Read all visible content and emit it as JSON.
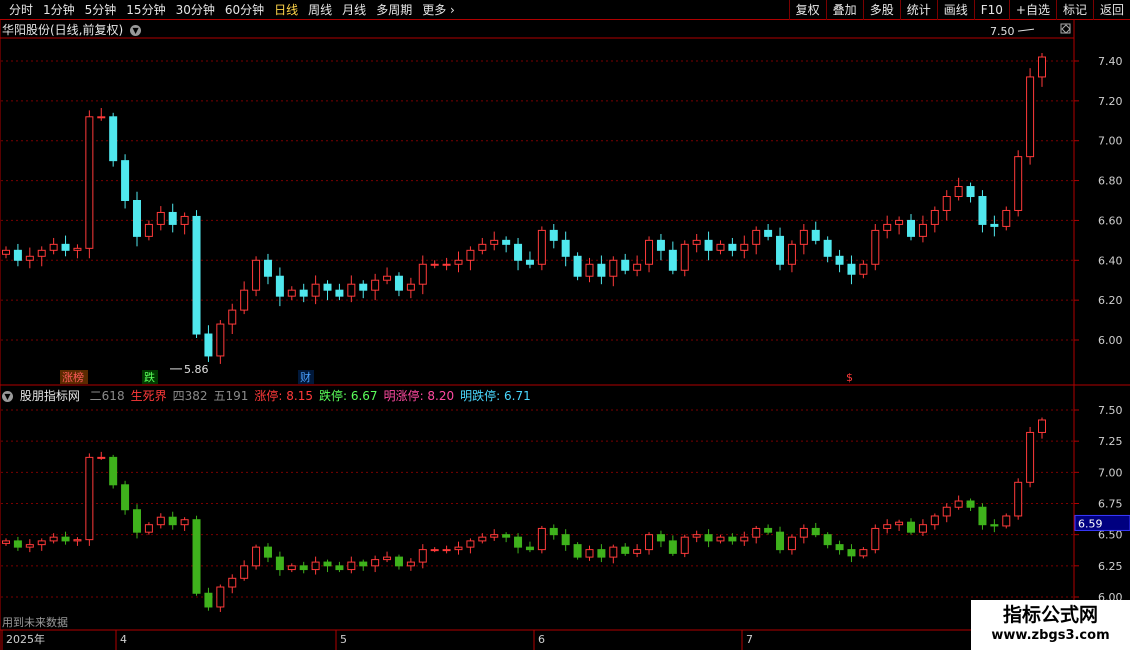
{
  "toolbar": {
    "periods": [
      "分时",
      "1分钟",
      "5分钟",
      "15分钟",
      "30分钟",
      "60分钟",
      "日线",
      "周线",
      "月线",
      "多周期",
      "更多"
    ],
    "active_period": "日线",
    "more_arrow": "›",
    "right_buttons": [
      "复权",
      "叠加",
      "多股",
      "统计",
      "画线",
      "F10",
      "+自选",
      "标记",
      "返回"
    ]
  },
  "main_panel": {
    "title": "华阳股份(日线,前复权)",
    "price_ticks": [
      "7.40",
      "7.20",
      "7.00",
      "6.80",
      "6.60",
      "6.40",
      "6.20",
      "6.00"
    ],
    "high_annotation": "7.50",
    "low_annotation": "5.86",
    "event_labels": [
      {
        "text": "涨榜",
        "color": "#ff5a5a",
        "bg": "#5a2a00"
      },
      {
        "text": "跌",
        "color": "#5aff5a",
        "bg": "#003a00"
      },
      {
        "text": "财",
        "color": "#4aa0ff",
        "bg": "#00183a"
      },
      {
        "text": "$",
        "color": "#ff3a3a",
        "bg": ""
      }
    ]
  },
  "indicator_panel": {
    "title": "股朋指标网",
    "items": [
      {
        "label": "二618",
        "value": "",
        "color": "#8a8a8a"
      },
      {
        "label": "生死界",
        "value": "",
        "color": "#ff3a3a"
      },
      {
        "label": "四382",
        "value": "",
        "color": "#8a8a8a"
      },
      {
        "label": "五191",
        "value": "",
        "color": "#8a8a8a"
      },
      {
        "label": "涨停",
        "value": "8.15",
        "color": "#ff3a3a"
      },
      {
        "label": "跌停",
        "value": "6.67",
        "color": "#5aff5a"
      },
      {
        "label": "明涨停",
        "value": "8.20",
        "color": "#ff4aa0"
      },
      {
        "label": "明跌停",
        "value": "6.71",
        "color": "#4ad8ff"
      }
    ],
    "price_ticks": [
      "7.50",
      "7.25",
      "7.00",
      "6.75",
      "6.50",
      "6.25",
      "6.00"
    ],
    "current_value": "6.59",
    "footer_note": "用到未来数据"
  },
  "time_axis": {
    "labels": [
      "2025年",
      "4",
      "5",
      "6",
      "7"
    ]
  },
  "watermark": {
    "main": "指标公式网",
    "sub": "www.zbgs3.com"
  },
  "colors": {
    "up": "#ff3a3a",
    "down": "#50e8ee",
    "down_green": "#3fb21c",
    "grid": "#7a0000",
    "border": "#b00000",
    "axis_text": "#cfcfcf"
  },
  "series_seed": {
    "count": 88,
    "closes": [
      6.45,
      6.4,
      6.42,
      6.45,
      6.48,
      6.45,
      6.46,
      7.12,
      7.12,
      6.9,
      6.7,
      6.52,
      6.58,
      6.64,
      6.58,
      6.62,
      6.03,
      5.92,
      6.08,
      6.15,
      6.25,
      6.4,
      6.32,
      6.22,
      6.25,
      6.22,
      6.28,
      6.25,
      6.22,
      6.28,
      6.25,
      6.3,
      6.32,
      6.25,
      6.28,
      6.38,
      6.38,
      6.38,
      6.4,
      6.45,
      6.48,
      6.5,
      6.48,
      6.4,
      6.38,
      6.55,
      6.5,
      6.42,
      6.32,
      6.38,
      6.32,
      6.4,
      6.35,
      6.38,
      6.5,
      6.45,
      6.35,
      6.48,
      6.5,
      6.45,
      6.48,
      6.45,
      6.48,
      6.55,
      6.52,
      6.38,
      6.48,
      6.55,
      6.5,
      6.42,
      6.38,
      6.33,
      6.38,
      6.55,
      6.58,
      6.6,
      6.52,
      6.58,
      6.65,
      6.72,
      6.77,
      6.72,
      6.58,
      6.57,
      6.65,
      6.92,
      7.32,
      7.42
    ]
  }
}
